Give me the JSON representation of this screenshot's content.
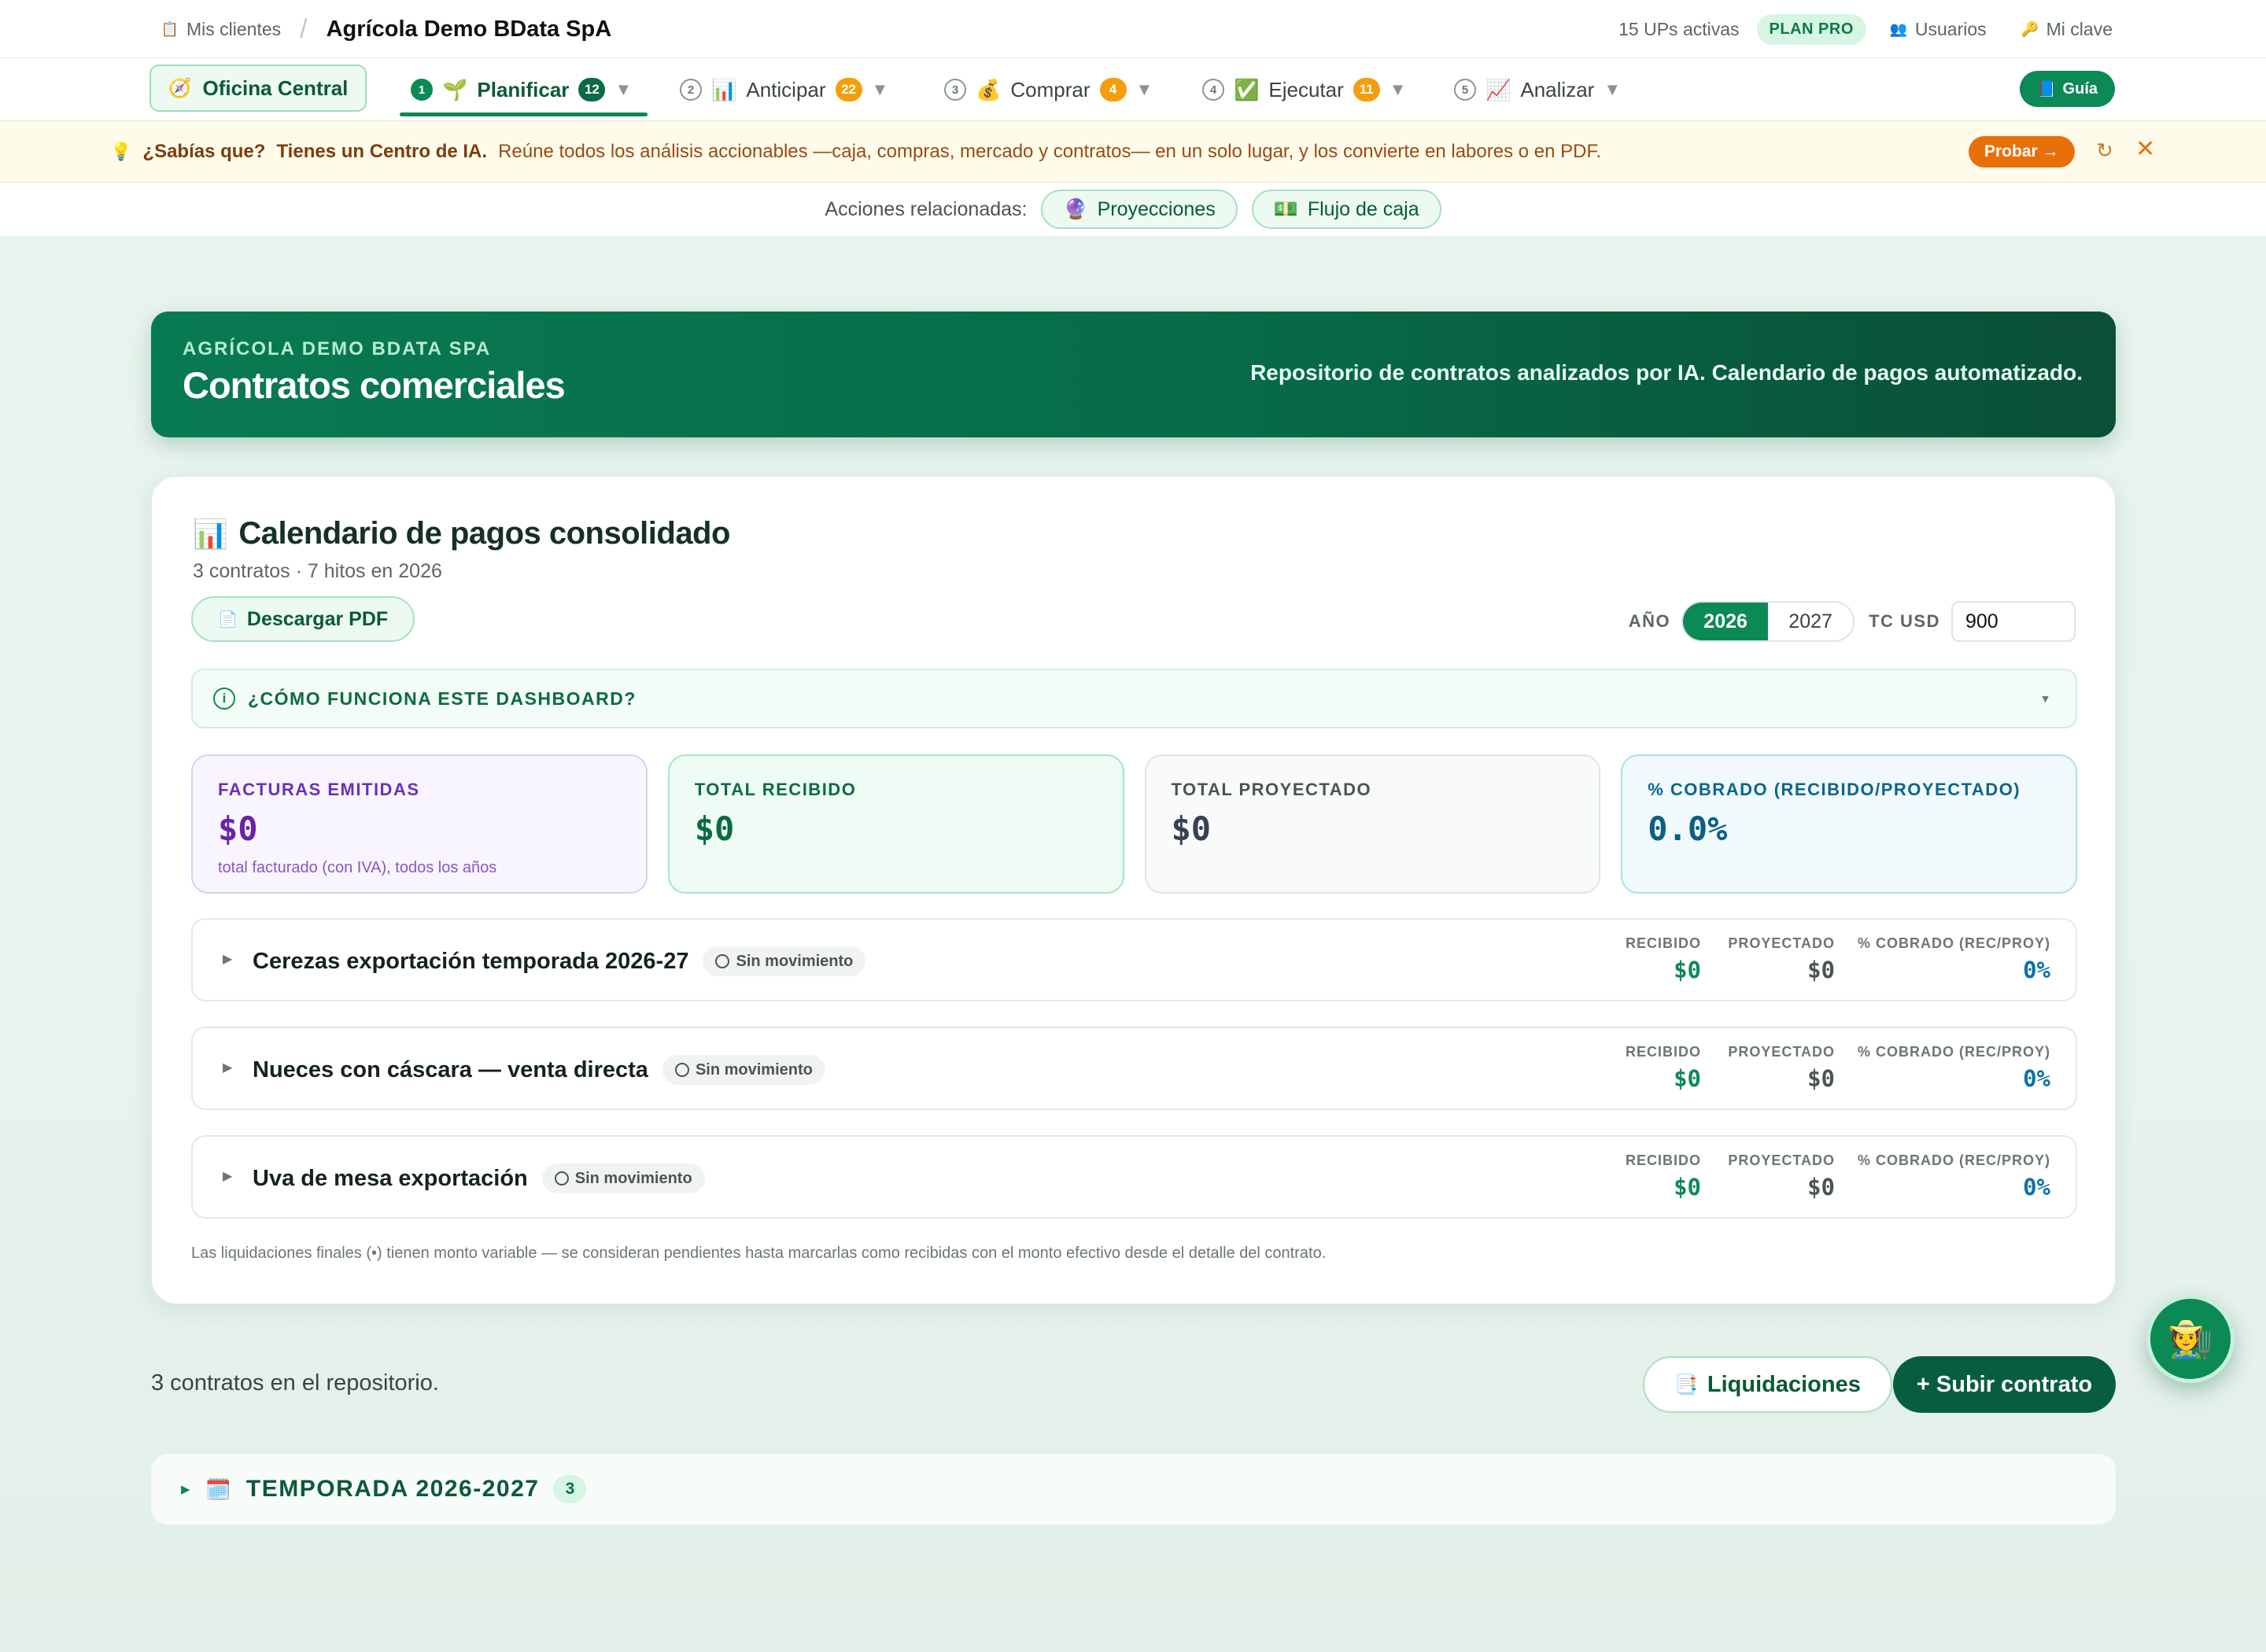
{
  "topbar": {
    "clients_label": "Mis clientes",
    "company": "Agrícola Demo BData SpA",
    "ups_active": "15 UPs activas",
    "plan": "PLAN PRO",
    "users_label": "Usuarios",
    "key_label": "Mi clave"
  },
  "nav": {
    "oficina": "Oficina Central",
    "items": [
      {
        "step": "1",
        "label": "Planificar",
        "badge": "12"
      },
      {
        "step": "2",
        "label": "Anticipar",
        "badge": "22"
      },
      {
        "step": "3",
        "label": "Comprar",
        "badge": "4"
      },
      {
        "step": "4",
        "label": "Ejecutar",
        "badge": "11"
      },
      {
        "step": "5",
        "label": "Analizar",
        "badge": ""
      }
    ],
    "guide": "Guía"
  },
  "tip": {
    "q": "¿Sabías que?",
    "headline": "Tienes un Centro de IA.",
    "body": "Reúne todos los análisis accionables —caja, compras, mercado y contratos— en un solo lugar, y los convierte en labores o en PDF.",
    "cta": "Probar →"
  },
  "related": {
    "label": "Acciones relacionadas:",
    "items": [
      "Proyecciones",
      "Flujo de caja"
    ]
  },
  "hero": {
    "eyebrow": "AGRÍCOLA DEMO BDATA SPA",
    "title": "Contratos comerciales",
    "desc": "Repositorio de contratos analizados por IA. Calendario de pagos automatizado."
  },
  "calendar": {
    "title": "Calendario de pagos consolidado",
    "subtitle": "3 contratos · 7 hitos en 2026",
    "pdf_button": "Descargar PDF",
    "year_label": "AÑO",
    "years": [
      "2026",
      "2027"
    ],
    "selected_year": "2026",
    "tc_label": "TC USD",
    "tc_value": "900",
    "howto": "¿CÓMO FUNCIONA ESTE DASHBOARD?",
    "kpis": [
      {
        "label": "FACTURAS EMITIDAS",
        "value": "$0",
        "note": "total facturado (con IVA), todos los años"
      },
      {
        "label": "TOTAL RECIBIDO",
        "value": "$0",
        "note": ""
      },
      {
        "label": "TOTAL PROYECTADO",
        "value": "$0",
        "note": ""
      },
      {
        "label": "% COBRADO (RECIBIDO/PROYECTADO)",
        "value": "0.0%",
        "note": ""
      }
    ],
    "metric_labels": {
      "recibido": "RECIBIDO",
      "proyectado": "PROYECTADO",
      "cobrado": "% COBRADO (REC/PROY)"
    },
    "contracts": [
      {
        "name": "Cerezas exportación temporada 2026-27",
        "status": "Sin movimiento",
        "recibido": "$0",
        "proyectado": "$0",
        "cobrado": "0%"
      },
      {
        "name": "Nueces con cáscara — venta directa",
        "status": "Sin movimiento",
        "recibido": "$0",
        "proyectado": "$0",
        "cobrado": "0%"
      },
      {
        "name": "Uva de mesa exportación",
        "status": "Sin movimiento",
        "recibido": "$0",
        "proyectado": "$0",
        "cobrado": "0%"
      }
    ],
    "footnote": "Las liquidaciones finales (•) tienen monto variable — se consideran pendientes hasta marcarlas como recibidas con el monto efectivo desde el detalle del contrato."
  },
  "repo": {
    "count_text": "3 contratos en el repositorio.",
    "liquidaciones": "Liquidaciones",
    "upload": "+ Subir contrato",
    "season_label": "TEMPORADA 2026-2027",
    "season_count": "3"
  }
}
